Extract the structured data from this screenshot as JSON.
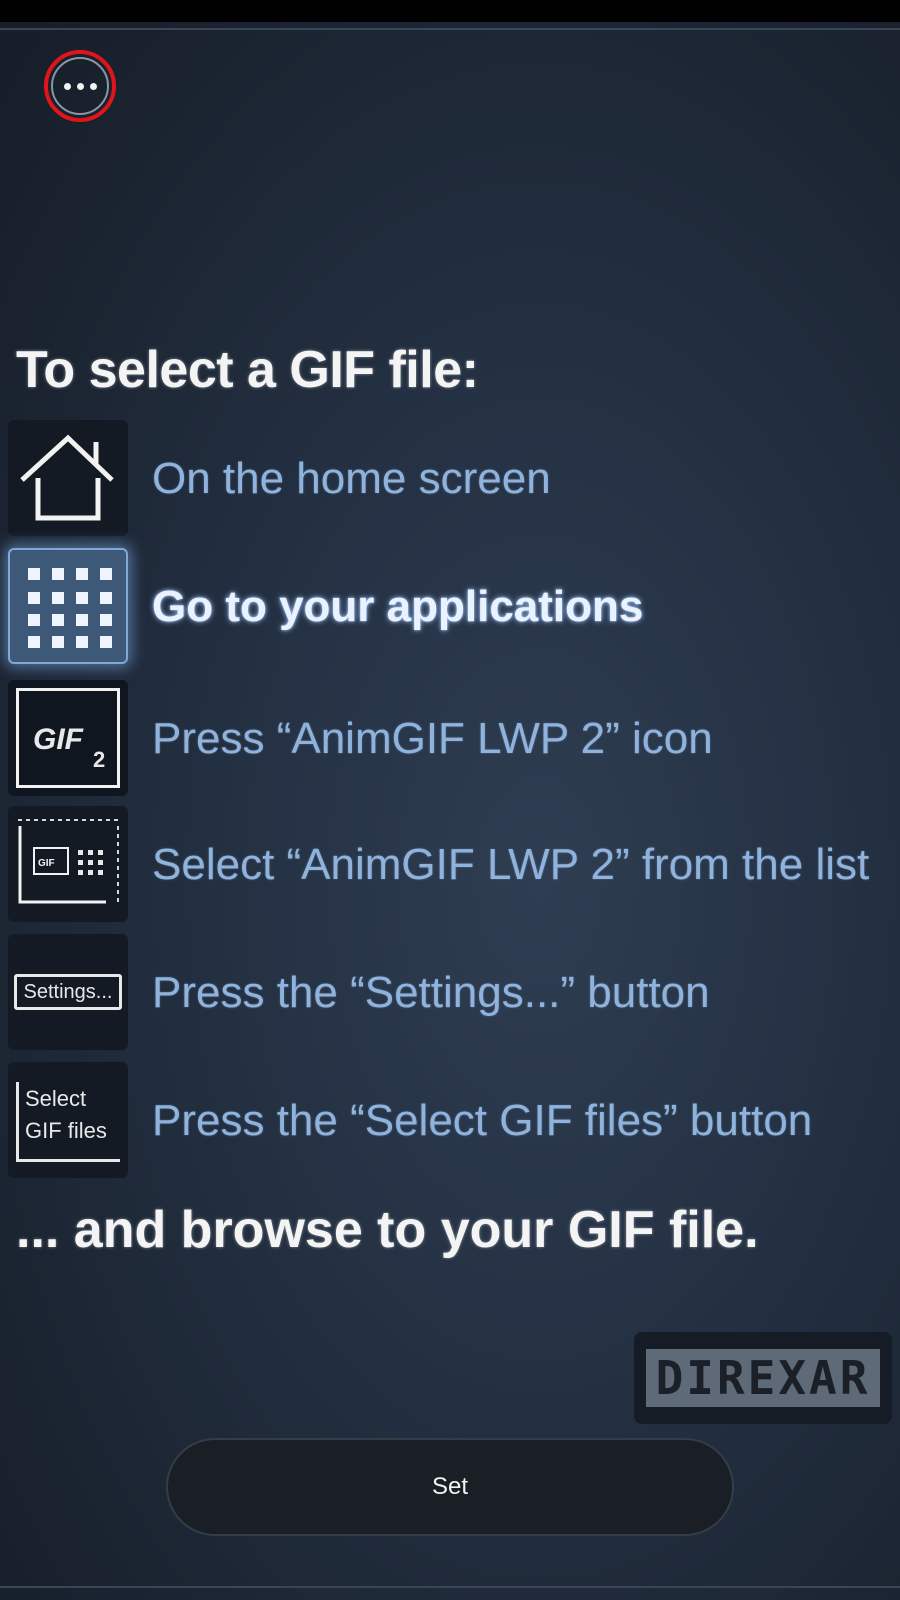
{
  "heading": "To select a GIF file:",
  "steps": [
    {
      "icon": "home-icon",
      "text": "On the home screen",
      "active": false
    },
    {
      "icon": "apps-grid-icon",
      "text": "Go to your applications",
      "active": true
    },
    {
      "icon": "gif2-app-icon",
      "text": "Press “AnimGIF LWP 2” icon",
      "active": false
    },
    {
      "icon": "wallpaper-list-icon",
      "text": "Select “AnimGIF LWP 2” from the list",
      "active": false
    },
    {
      "icon": "settings-button-icon",
      "text": "Press the “Settings...” button",
      "active": false
    },
    {
      "icon": "select-gif-button-icon",
      "text": "Press the “Select GIF files” button",
      "active": false
    }
  ],
  "icon_labels": {
    "gif": "GIF",
    "gif_sub": "2",
    "settings": "Settings...",
    "select_line1": "Select",
    "select_line2": "GIF files"
  },
  "footer": "... and browse to your GIF file.",
  "logo": "DIREXAR",
  "set_button": "Set",
  "colors": {
    "accent_ring": "#e0141b",
    "step_text": "#8fb3dc",
    "heading_text": "#f4f4f4"
  }
}
